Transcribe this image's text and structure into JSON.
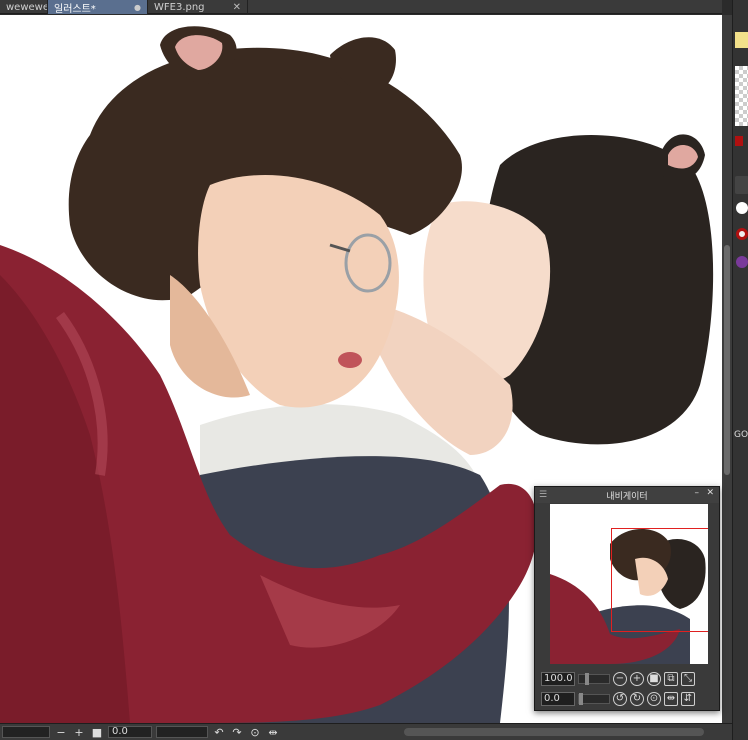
{
  "tabs": [
    {
      "label": "wewewe",
      "close": "✕",
      "active": false
    },
    {
      "label": "일러스트*",
      "modified": "●",
      "active": true
    },
    {
      "label": "WFE3.png",
      "close": "✕",
      "active": false
    }
  ],
  "navigator": {
    "title": "내비게이터",
    "zoom_value": "100.0",
    "rotation_value": "0.0"
  },
  "statusbar": {
    "zoom_value": "",
    "rotation_value": "0.0"
  },
  "right_panel": {
    "label_go": "GO"
  },
  "colors": {
    "canvas": "#ffffff",
    "active_tab": "#5a6f8f",
    "nav_frame": "#e02020",
    "coat": "#8a2232",
    "dark_hair": "#2a1f19"
  },
  "icons": [
    "close-icon",
    "zoom-out-icon",
    "zoom-in-icon",
    "fit-icon",
    "rotate-left-icon",
    "rotate-right-icon",
    "reset-rotation-icon",
    "flip-horizontal-icon",
    "flip-vertical-icon"
  ]
}
